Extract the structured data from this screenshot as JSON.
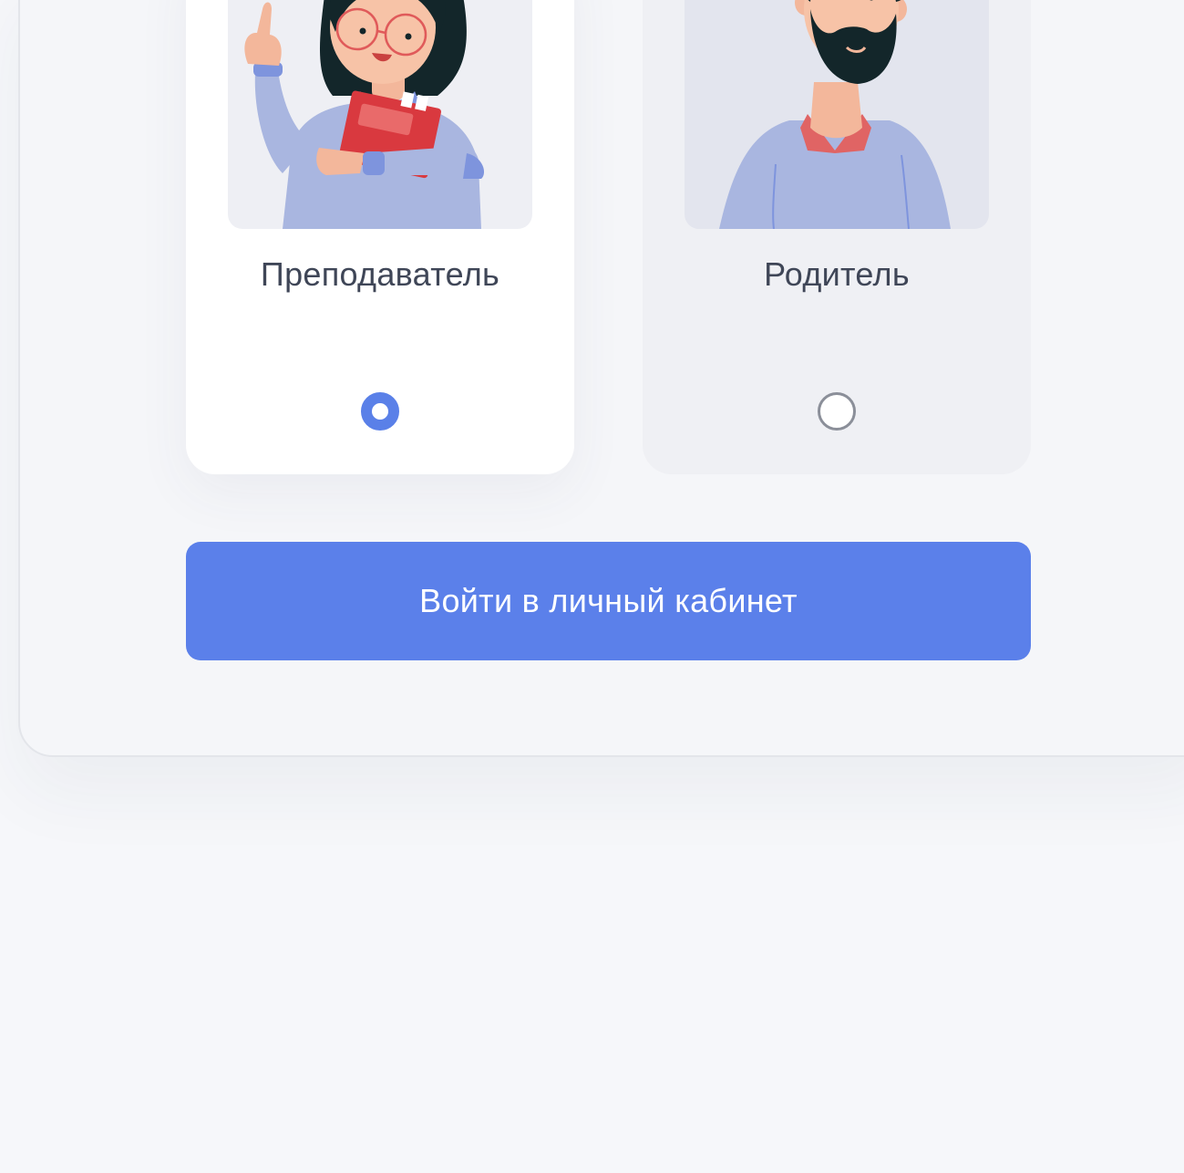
{
  "roles": [
    {
      "label": "Преподаватель",
      "selected": true
    },
    {
      "label": "Родитель",
      "selected": false
    }
  ],
  "login_button": {
    "label": "Войти в личный кабинет"
  },
  "colors": {
    "accent": "#5b80ea",
    "background": "#f6f7fa",
    "card_selected": "#ffffff",
    "card_unselected": "#eff0f4",
    "text": "#3f4657"
  }
}
